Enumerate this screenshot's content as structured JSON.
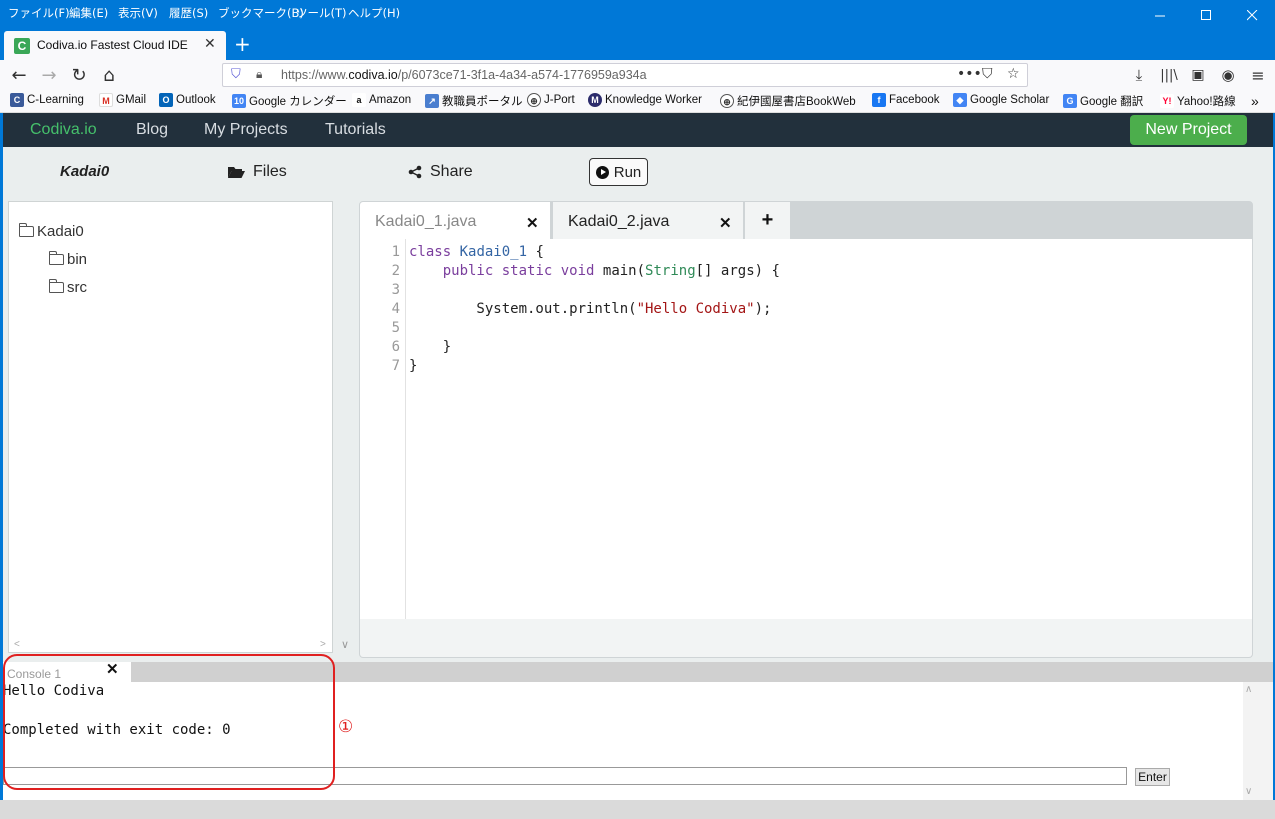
{
  "browser": {
    "menu": [
      "ファイル(F)",
      "編集(E)",
      "表示(V)",
      "履歴(S)",
      "ブックマーク(B)",
      "ツール(T)",
      "ヘルプ(H)"
    ],
    "tab_title": "Codiva.io Fastest Cloud IDE",
    "tab_favicon": "C",
    "url_prefix": "https://www.",
    "url_host": "codiva.io",
    "url_path": "/p/6073ce71-3f1a-4a34-a574-1776959a934a",
    "bookmarks": [
      "C-Learning",
      "GMail",
      "Outlook",
      "Google カレンダー",
      "Amazon",
      "教職員ポータル",
      "J-Port",
      "Knowledge Worker",
      "紀伊國屋書店BookWeb",
      "Facebook",
      "Google Scholar",
      "Google 翻訳",
      "Yahoo!路線"
    ],
    "accent_color": "#0078d7"
  },
  "app": {
    "brand": "Codiva.io",
    "nav": [
      "Blog",
      "My Projects",
      "Tutorials"
    ],
    "new_project": "New Project",
    "project_name": "Kadai0",
    "files_label": "Files",
    "share_label": "Share",
    "run_label": "Run",
    "tree": {
      "root": "Kadai0",
      "children": [
        "bin",
        "src"
      ]
    },
    "tabs": [
      {
        "label": "Kadai0_1.java"
      },
      {
        "label": "Kadai0_2.java"
      }
    ],
    "add_tab": "+",
    "line_numbers": [
      "1",
      "2",
      "3",
      "4",
      "5",
      "6",
      "7"
    ],
    "console": {
      "tab_label": "Console 1",
      "lines": [
        "Hello Codiva",
        "",
        "Completed with exit code: 0"
      ],
      "enter_label": "Enter"
    },
    "annotation": "①",
    "brand_color": "#45c06b",
    "new_project_color": "#4cae4c",
    "highlight_color": "#e02020"
  }
}
